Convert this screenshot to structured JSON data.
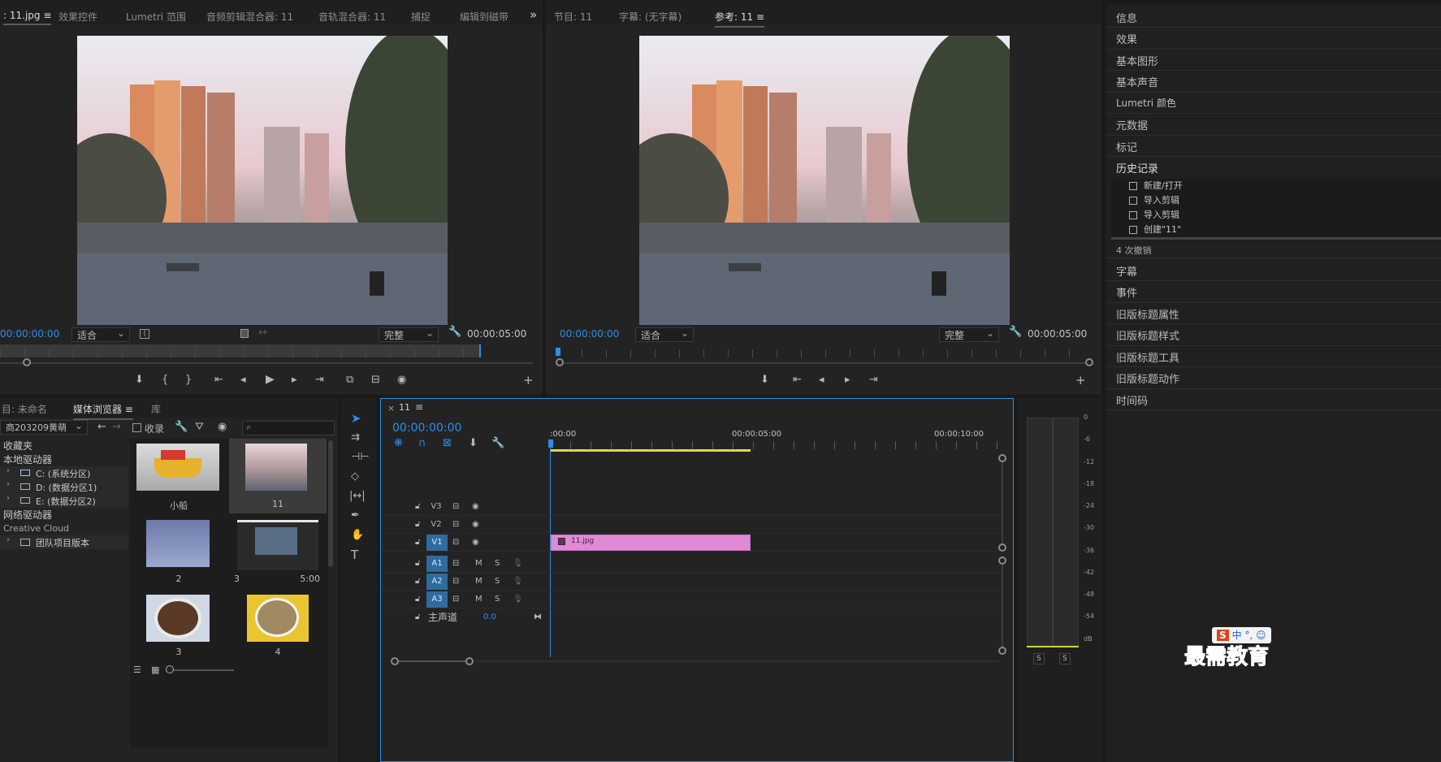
{
  "source_panel": {
    "tabs": [
      {
        "label": ": 11.jpg ≡",
        "active": true
      },
      {
        "label": "效果控件",
        "active": false
      },
      {
        "label": "Lumetri 范围",
        "active": false
      },
      {
        "label": "音频剪辑混合器: 11",
        "active": false
      },
      {
        "label": "音轨混合器: 11",
        "active": false
      },
      {
        "label": "捕捉",
        "active": false
      },
      {
        "label": "编辑到磁带",
        "active": false
      }
    ],
    "more": "»",
    "timecode_left": "00:00:00:00",
    "fit_label": "适合",
    "quality_label": "完整",
    "timecode_right": "00:00:05:00"
  },
  "program_panel": {
    "tabs": [
      {
        "label": "节目: 11",
        "active": false
      },
      {
        "label": "字幕: (无字幕)",
        "active": false
      },
      {
        "label": "参考: 11 ≡",
        "active": true
      }
    ],
    "timecode_left": "00:00:00:00",
    "fit_label": "适合",
    "quality_label": "完整",
    "timecode_right": "00:00:05:00"
  },
  "right_panel": {
    "items": [
      "信息",
      "效果",
      "基本图形",
      "基本声音",
      "Lumetri 颜色",
      "元数据",
      "标记",
      "历史记录"
    ],
    "history": [
      "新建/打开",
      "导入剪辑",
      "导入剪辑",
      "创建\"11\""
    ],
    "undo_count": "4 次撤销",
    "items_after": [
      "字幕",
      "事件",
      "旧版标题属性",
      "旧版标题样式",
      "旧版标题工具",
      "旧版标题动作",
      "时间码"
    ]
  },
  "media_browser": {
    "tabs": [
      {
        "label": "目: 未命名",
        "active": false
      },
      {
        "label": "媒体浏览器 ≡",
        "active": true
      },
      {
        "label": "库",
        "active": false
      }
    ],
    "path_dropdown": "商203209黄萌",
    "collect_label": "收录",
    "tree": [
      {
        "label": "收藏夹",
        "indent": 0
      },
      {
        "label": "本地驱动器",
        "indent": 0
      },
      {
        "label": "C: (系统分区)",
        "indent": 1
      },
      {
        "label": "D: (数据分区1)",
        "indent": 1
      },
      {
        "label": "E: (数据分区2)",
        "indent": 1
      },
      {
        "label": "网络驱动器",
        "indent": 0
      },
      {
        "label": "Creative Cloud",
        "indent": 0
      },
      {
        "label": "团队项目版本",
        "indent": 1
      }
    ],
    "thumbs": [
      {
        "label": "小船",
        "duration": ""
      },
      {
        "label": "11",
        "duration": ""
      },
      {
        "label": "2",
        "duration": ""
      },
      {
        "label": "3",
        "duration": "5:00"
      },
      {
        "label": "3",
        "duration": ""
      },
      {
        "label": "4",
        "duration": ""
      }
    ]
  },
  "timeline": {
    "tab_close": "×",
    "sequence_name": "11",
    "menu": "≡",
    "timecode": "00:00:00:00",
    "ruler_labels": [
      ":00:00",
      "00:00:05:00",
      "00:00:10:00"
    ],
    "tracks": [
      {
        "name": "V3",
        "type": "video"
      },
      {
        "name": "V2",
        "type": "video"
      },
      {
        "name": "V1",
        "type": "video"
      },
      {
        "name": "A1",
        "type": "audio"
      },
      {
        "name": "A2",
        "type": "audio"
      },
      {
        "name": "A3",
        "type": "audio"
      }
    ],
    "master_label": "主声道",
    "master_value": "0.0",
    "clip_label": "11.jpg",
    "clip_color": "#e08ad7"
  },
  "meter": {
    "scale": [
      "0",
      "-6",
      "-12",
      "-18",
      "-24",
      "-30",
      "-36",
      "-42",
      "-48",
      "-54",
      "dB"
    ],
    "solo_left": "S",
    "solo_right": "S"
  },
  "watermark": {
    "text": "最需教育",
    "ime": "中 °, ☺"
  },
  "colors": {
    "accent_blue": "#2d8ceb",
    "panel_bg": "#232323",
    "clip_pink": "#e08ad7"
  }
}
